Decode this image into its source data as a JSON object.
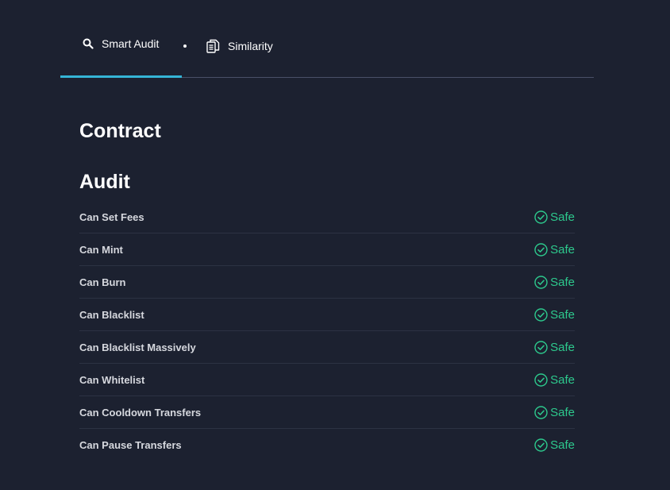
{
  "tabs": [
    {
      "label": "Smart Audit",
      "icon": "search-icon",
      "active": true
    },
    {
      "label": "Similarity",
      "icon": "document-icon",
      "active": false
    }
  ],
  "sections": {
    "contract_title": "Contract",
    "audit_title": "Audit"
  },
  "audit": {
    "items": [
      {
        "label": "Can Set Fees",
        "status": "Safe"
      },
      {
        "label": "Can Mint",
        "status": "Safe"
      },
      {
        "label": "Can Burn",
        "status": "Safe"
      },
      {
        "label": "Can Blacklist",
        "status": "Safe"
      },
      {
        "label": "Can Blacklist Massively",
        "status": "Safe"
      },
      {
        "label": "Can Whitelist",
        "status": "Safe"
      },
      {
        "label": "Can Cooldown Transfers",
        "status": "Safe"
      },
      {
        "label": "Can Pause Transfers",
        "status": "Safe"
      }
    ]
  },
  "colors": {
    "background": "#1c2130",
    "accent": "#35b5d6",
    "safe": "#2dc98d"
  }
}
